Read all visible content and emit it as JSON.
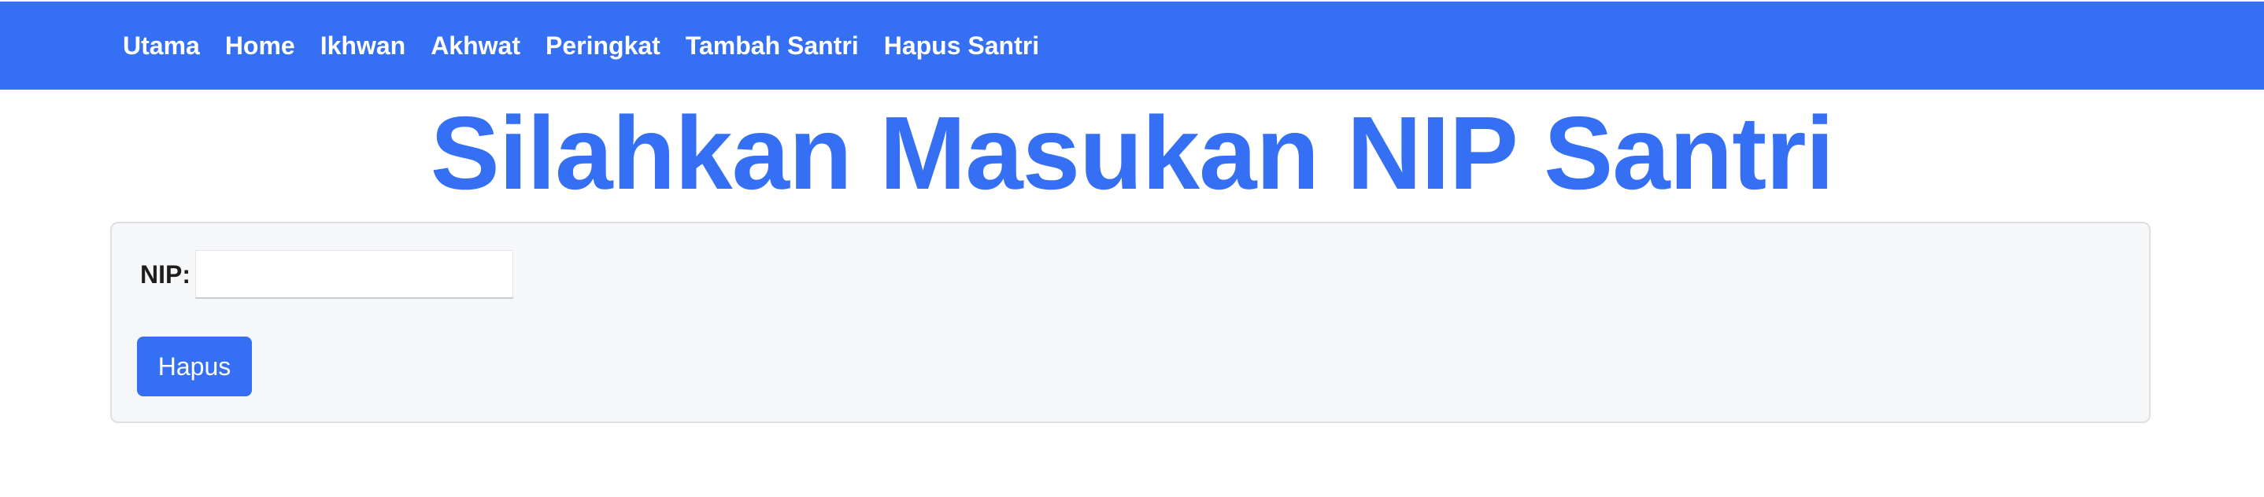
{
  "navbar": {
    "items": [
      {
        "label": "Utama"
      },
      {
        "label": "Home"
      },
      {
        "label": "Ikhwan"
      },
      {
        "label": "Akhwat"
      },
      {
        "label": "Peringkat"
      },
      {
        "label": "Tambah Santri"
      },
      {
        "label": "Hapus Santri"
      }
    ]
  },
  "main": {
    "title": "Silahkan Masukan NIP Santri",
    "form": {
      "nip_label": "NIP:",
      "nip_value": "",
      "submit_label": "Hapus"
    }
  },
  "colors": {
    "accent": "#356ff3",
    "card_background": "#f6f7f9",
    "card_border": "#dcdee2"
  }
}
